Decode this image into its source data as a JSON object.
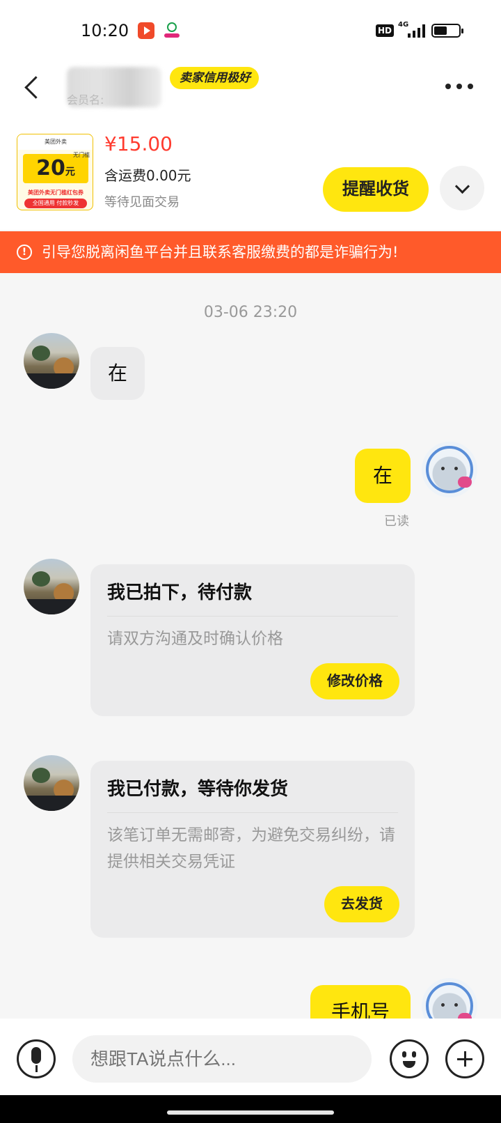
{
  "status_bar": {
    "time": "10:20",
    "network": "4G",
    "hd": "HD"
  },
  "header": {
    "seller_name_hint": "会员名:",
    "credit_badge": "卖家信用极好"
  },
  "product": {
    "price": "¥15.00",
    "shipping": "含运费0.00元",
    "trade_type": "等待见面交易",
    "image_text": {
      "brand": "美团外卖",
      "amount": "20",
      "unit": "元",
      "tag": "无门槛",
      "line1": "美团外卖无门槛红包券",
      "line2": "全国通用 付款秒发"
    },
    "remind_button": "提醒收货"
  },
  "warning": {
    "icon": "!",
    "text": "引导您脱离闲鱼平台并且联系客服缴费的都是诈骗行为!"
  },
  "chat": {
    "timestamp": "03-06 23:20",
    "messages": [
      {
        "side": "left",
        "text": "在"
      },
      {
        "side": "right",
        "text": "在",
        "status": "已读"
      }
    ],
    "cards": [
      {
        "title": "我已拍下，待付款",
        "desc": "请双方沟通及时确认价格",
        "button": "修改价格"
      },
      {
        "title": "我已付款，等待你发货",
        "desc": "该笔订单无需邮寄，为避免交易纠纷，请提供相关交易凭证",
        "button": "去发货"
      }
    ],
    "last_message": {
      "side": "right",
      "text": "手机号"
    }
  },
  "input_bar": {
    "placeholder": "想跟TA说点什么..."
  },
  "colors": {
    "accent_yellow": "#ffe60f",
    "warning_orange": "#ff5a2a",
    "price_red": "#ff3b2f"
  }
}
